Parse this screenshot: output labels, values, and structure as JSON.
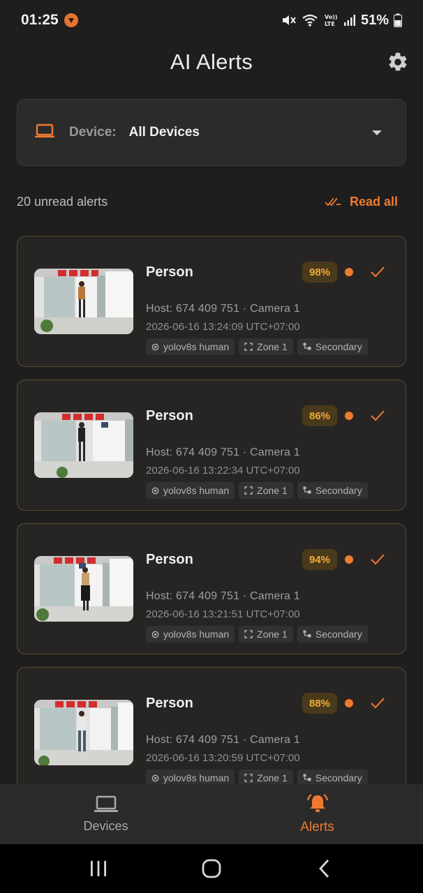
{
  "status_bar": {
    "time": "01:25",
    "battery": "51%",
    "icons": [
      "app-notification-icon",
      "mute-icon",
      "wifi-icon",
      "volte-icon",
      "signal-icon",
      "battery-icon"
    ]
  },
  "header": {
    "title": "AI Alerts",
    "settings_icon": "gear-icon"
  },
  "device_selector": {
    "icon": "laptop-icon",
    "label": "Device:",
    "value": "All Devices"
  },
  "unread": {
    "count_text": "20 unread alerts",
    "read_all_label": "Read all"
  },
  "alerts": [
    {
      "title": "Person",
      "confidence": "98%",
      "host": "Host: 674 409 751 · Camera 1",
      "timestamp": "2026-06-16 13:24:09 UTC+07:00",
      "tags": [
        "yolov8s human",
        "Zone 1",
        "Secondary"
      ]
    },
    {
      "title": "Person",
      "confidence": "86%",
      "host": "Host: 674 409 751 · Camera 1",
      "timestamp": "2026-06-16 13:22:34 UTC+07:00",
      "tags": [
        "yolov8s human",
        "Zone 1",
        "Secondary"
      ]
    },
    {
      "title": "Person",
      "confidence": "94%",
      "host": "Host: 674 409 751 · Camera 1",
      "timestamp": "2026-06-16 13:21:51 UTC+07:00",
      "tags": [
        "yolov8s human",
        "Zone 1",
        "Secondary"
      ]
    },
    {
      "title": "Person",
      "confidence": "88%",
      "host": "Host: 674 409 751 · Camera 1",
      "timestamp": "2026-06-16 13:20:59 UTC+07:00",
      "tags": [
        "yolov8s human",
        "Zone 1",
        "Secondary"
      ]
    }
  ],
  "bottom_nav": {
    "items": [
      {
        "label": "Devices",
        "icon": "laptop-icon",
        "active": false
      },
      {
        "label": "Alerts",
        "icon": "bell-icon",
        "active": true
      }
    ]
  },
  "system_nav": [
    "recents-button",
    "home-button",
    "back-button"
  ],
  "colors": {
    "accent": "#f07b2f",
    "background": "#1e1e1e",
    "card": "#272523",
    "badge": "#f0ac3a"
  }
}
